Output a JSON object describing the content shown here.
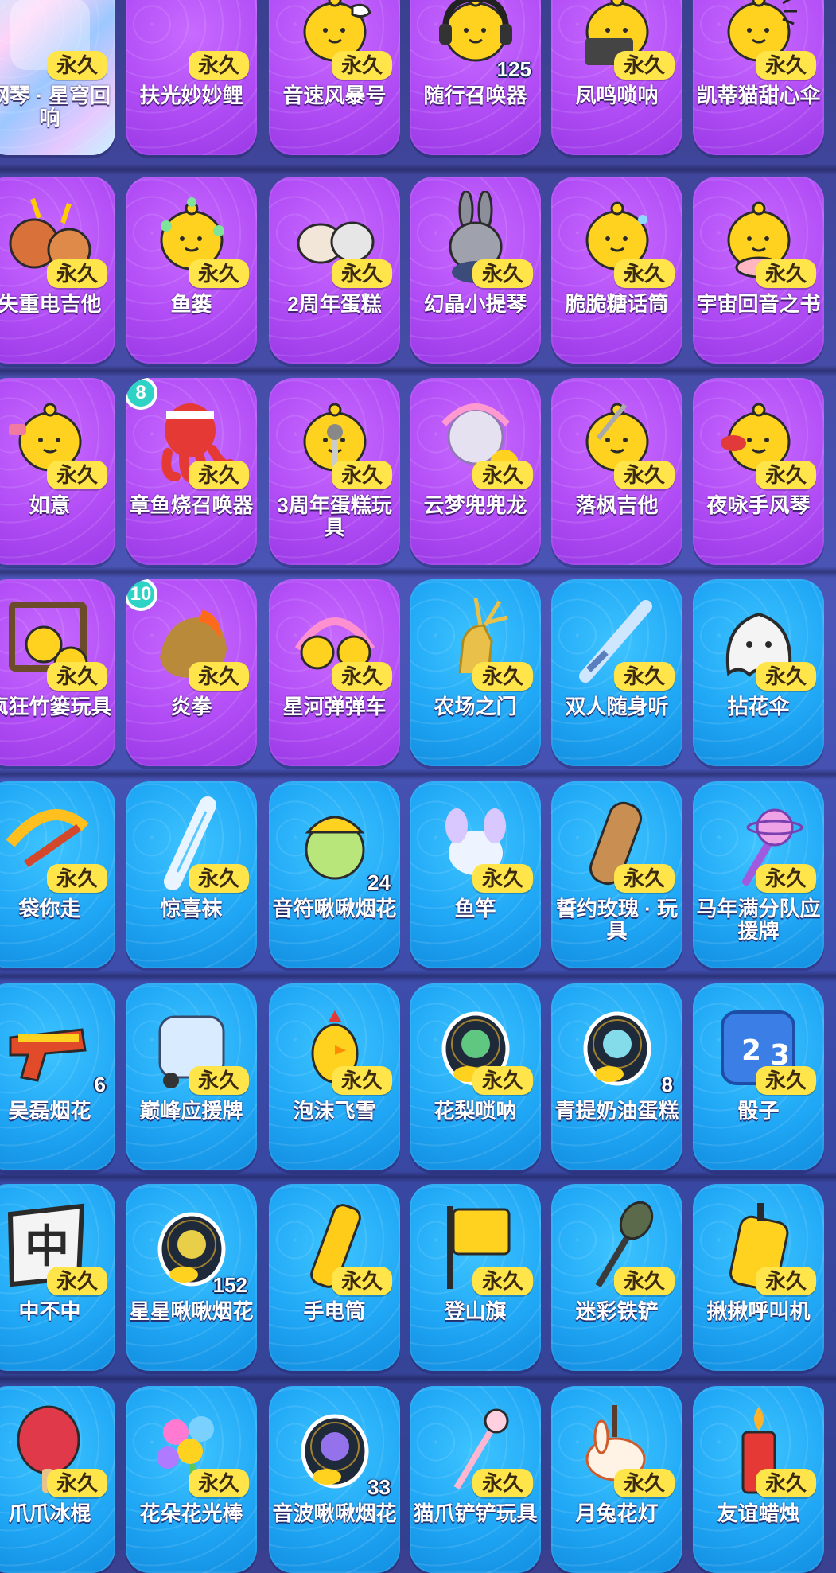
{
  "labels": {
    "permanent": "永久"
  },
  "rows": [
    {
      "tiles": [
        {
          "name": "钢琴 · 星穹回响",
          "style": "holo",
          "icon": "piano-icon",
          "badge": true
        },
        {
          "name": "扶光妙妙鲤",
          "style": "purple",
          "icon": "blank-icon",
          "badge": true
        },
        {
          "name": "音速风暴号",
          "style": "purple",
          "icon": "chick-whistle-icon",
          "badge": true
        },
        {
          "name": "随行召唤器",
          "style": "purple",
          "icon": "chick-headphones-icon",
          "badge": false,
          "count": "125"
        },
        {
          "name": "凤鸣唢呐",
          "style": "purple",
          "icon": "chick-laptop-icon",
          "badge": true
        },
        {
          "name": "凯蒂猫甜心伞",
          "style": "purple",
          "icon": "chick-shock-icon",
          "badge": true
        }
      ]
    },
    {
      "tiles": [
        {
          "name": "失重电吉他",
          "style": "purple",
          "icon": "bear-pair-icon",
          "badge": true
        },
        {
          "name": "鱼篓",
          "style": "purple",
          "icon": "chick-money-icon",
          "badge": true
        },
        {
          "name": "2周年蛋糕",
          "style": "purple",
          "icon": "dog-cat-icon",
          "badge": true
        },
        {
          "name": "幻晶小提琴",
          "style": "purple",
          "icon": "rabbit-icon",
          "badge": true
        },
        {
          "name": "脆脆糖话筒",
          "style": "purple",
          "icon": "chick-sweat-icon",
          "badge": true
        },
        {
          "name": "宇宙回音之书",
          "style": "purple",
          "icon": "chick-cake-icon",
          "badge": true
        }
      ]
    },
    {
      "tiles": [
        {
          "name": "如意",
          "style": "purple",
          "icon": "chick-cup-icon",
          "badge": true
        },
        {
          "name": "章鱼烧召唤器",
          "style": "purple",
          "icon": "octopus-icon",
          "badge": true,
          "corner": "8"
        },
        {
          "name": "3周年蛋糕玩具",
          "style": "purple",
          "icon": "chick-mic-icon",
          "badge": true
        },
        {
          "name": "云梦兜兜龙",
          "style": "purple",
          "icon": "anime-girl-icon",
          "badge": true
        },
        {
          "name": "落枫吉他",
          "style": "purple",
          "icon": "chick-sword-icon",
          "badge": true
        },
        {
          "name": "夜咏手风琴",
          "style": "purple",
          "icon": "chick-bowl-icon",
          "badge": true
        }
      ]
    },
    {
      "tiles": [
        {
          "name": "疯狂竹篓玩具",
          "style": "purple",
          "icon": "frame-chick-icon",
          "badge": true
        },
        {
          "name": "炎拳",
          "style": "purple",
          "icon": "fire-fist-icon",
          "badge": true,
          "corner": "10"
        },
        {
          "name": "星河弹弹车",
          "style": "purple",
          "icon": "chick-rainbow-icon",
          "badge": true
        },
        {
          "name": "农场之门",
          "style": "blue",
          "icon": "golden-deer-icon",
          "badge": true
        },
        {
          "name": "双人随身听",
          "style": "blue",
          "icon": "guitar-icon",
          "badge": true
        },
        {
          "name": "拈花伞",
          "style": "blue",
          "icon": "ghost-icon",
          "badge": true
        }
      ]
    },
    {
      "tiles": [
        {
          "name": "袋你走",
          "style": "blue",
          "icon": "crossbow-icon",
          "badge": true
        },
        {
          "name": "惊喜袜",
          "style": "blue",
          "icon": "ruler-harp-icon",
          "badge": true
        },
        {
          "name": "音符啾啾烟花",
          "style": "blue",
          "icon": "bird-hat-icon",
          "badge": false,
          "count": "24"
        },
        {
          "name": "鱼竿",
          "style": "blue",
          "icon": "crystal-pony-icon",
          "badge": true
        },
        {
          "name": "誓约玫瑰 · 玩具",
          "style": "blue",
          "icon": "wood-guzheng-icon",
          "badge": true
        },
        {
          "name": "马年满分队应援牌",
          "style": "blue",
          "icon": "planet-wand-icon",
          "badge": true
        }
      ]
    },
    {
      "tiles": [
        {
          "name": "吴磊烟花",
          "style": "blue",
          "icon": "toy-gun-icon",
          "badge": false,
          "count": "6"
        },
        {
          "name": "巅峰应援牌",
          "style": "blue",
          "icon": "tuk-tuk-icon",
          "badge": true
        },
        {
          "name": "泡沫飞雪",
          "style": "blue",
          "icon": "rubber-chicken-icon",
          "badge": true
        },
        {
          "name": "花梨唢呐",
          "style": "blue",
          "icon": "clover-egg-icon",
          "badge": true
        },
        {
          "name": "青提奶油蛋糕",
          "style": "blue",
          "icon": "orb-egg-icon",
          "badge": false,
          "count": "8"
        },
        {
          "name": "骰子",
          "style": "blue",
          "icon": "dice-icon",
          "badge": true
        }
      ]
    },
    {
      "tiles": [
        {
          "name": "中不中",
          "style": "blue",
          "icon": "zhong-sign-icon",
          "badge": true
        },
        {
          "name": "星星啾啾烟花",
          "style": "blue",
          "icon": "star-egg-icon",
          "badge": false,
          "count": "152"
        },
        {
          "name": "手电筒",
          "style": "blue",
          "icon": "flashlight-icon",
          "badge": true
        },
        {
          "name": "登山旗",
          "style": "blue",
          "icon": "flag-icon",
          "badge": true
        },
        {
          "name": "迷彩铁铲",
          "style": "blue",
          "icon": "shovel-icon",
          "badge": true
        },
        {
          "name": "揪揪呼叫机",
          "style": "blue",
          "icon": "walkie-talkie-icon",
          "badge": true
        }
      ]
    },
    {
      "tiles": [
        {
          "name": "爪爪冰棍",
          "style": "blue",
          "icon": "popsicle-icon",
          "badge": true
        },
        {
          "name": "花朵花光棒",
          "style": "blue",
          "icon": "flower-balloon-icon",
          "badge": true
        },
        {
          "name": "音波啾啾烟花",
          "style": "blue",
          "icon": "galaxy-egg-icon",
          "badge": false,
          "count": "33"
        },
        {
          "name": "猫爪铲铲玩具",
          "style": "blue",
          "icon": "paw-wand-icon",
          "badge": true
        },
        {
          "name": "月兔花灯",
          "style": "blue",
          "icon": "rabbit-lantern-icon",
          "badge": true
        },
        {
          "name": "友谊蜡烛",
          "style": "blue",
          "icon": "candle-icon",
          "badge": true
        }
      ]
    }
  ]
}
